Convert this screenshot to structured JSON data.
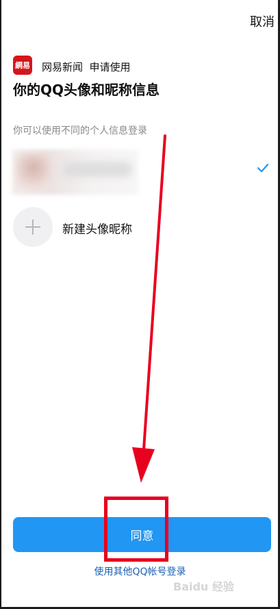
{
  "header": {
    "cancel_label": "取消"
  },
  "app": {
    "logo_text": "網易",
    "name_line": "网易新闻  申请使用"
  },
  "title": "你的QQ头像和昵称信息",
  "subtitle": "你可以使用不同的个人信息登录",
  "account": {
    "selected": true
  },
  "new_profile": {
    "label": "新建头像昵称"
  },
  "actions": {
    "agree_label": "同意",
    "other_login_label": "使用其他QQ帐号登录"
  },
  "colors": {
    "primary": "#2196f3",
    "annotation": "#e8001f",
    "link": "#1a5fb4",
    "logo": "#d4161b"
  },
  "watermark": {
    "text": "Baidu 经验"
  }
}
